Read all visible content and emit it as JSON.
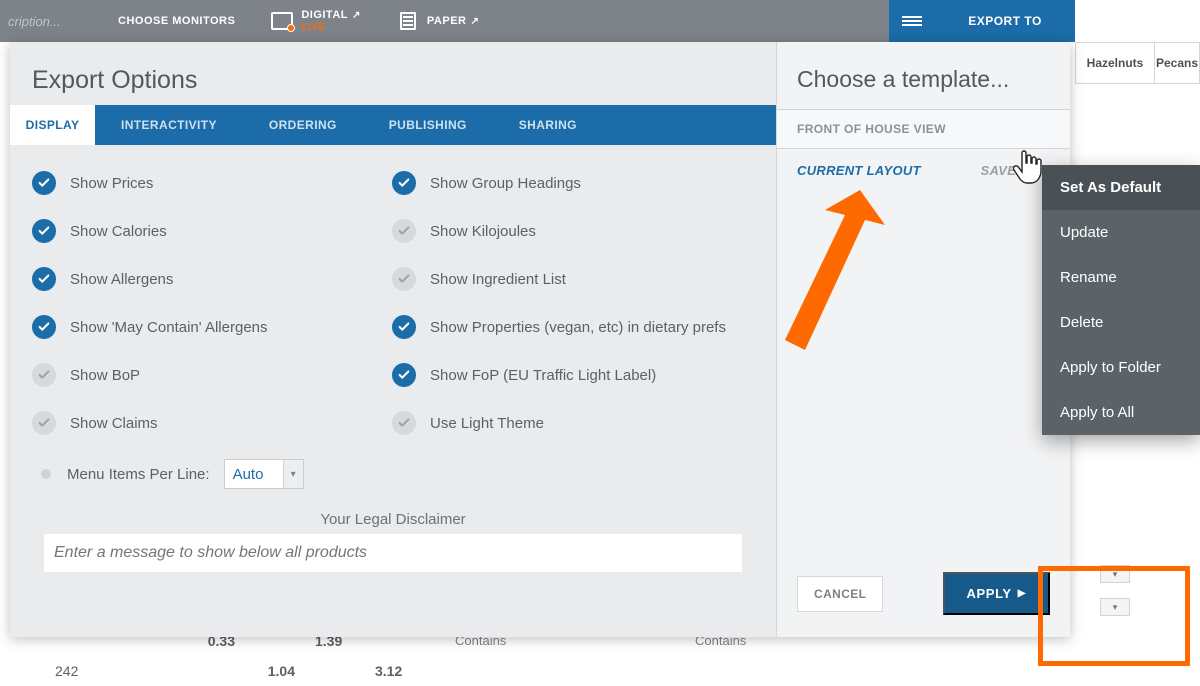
{
  "toolbar": {
    "description_placeholder": "cription...",
    "choose_monitors": "CHOOSE MONITORS",
    "digital": "DIGITAL",
    "digital_sub": "LIVE",
    "paper": "PAPER",
    "export_to": "EXPORT TO"
  },
  "bg_tabs": {
    "hazelnuts": "Hazelnuts",
    "pecans": "Pecans"
  },
  "panel": {
    "title": "Export Options",
    "tabs": [
      "DISPLAY",
      "INTERACTIVITY",
      "ORDERING",
      "PUBLISHING",
      "SHARING"
    ],
    "active_tab": 0,
    "options_left": [
      {
        "label": "Show Prices",
        "on": true
      },
      {
        "label": "Show Calories",
        "on": true
      },
      {
        "label": "Show Allergens",
        "on": true
      },
      {
        "label": "Show 'May Contain' Allergens",
        "on": true
      },
      {
        "label": "Show BoP",
        "on": false
      },
      {
        "label": "Show Claims",
        "on": false
      }
    ],
    "options_right": [
      {
        "label": "Show Group Headings",
        "on": true
      },
      {
        "label": "Show Kilojoules",
        "on": false
      },
      {
        "label": "Show Ingredient List",
        "on": false
      },
      {
        "label": "Show Properties (vegan, etc) in dietary prefs",
        "on": true
      },
      {
        "label": "Show FoP (EU Traffic Light Label)",
        "on": true
      },
      {
        "label": "Use Light Theme",
        "on": false
      }
    ],
    "per_line_label": "Menu Items Per Line:",
    "per_line_value": "Auto",
    "legal_label": "Your Legal Disclaimer",
    "legal_placeholder": "Enter a message to show below all products"
  },
  "template": {
    "title": "Choose a template...",
    "section": "FRONT OF HOUSE VIEW",
    "current": "CURRENT LAYOUT",
    "save_as": "SAVE AS...",
    "cancel": "CANCEL",
    "apply": "APPLY"
  },
  "context_menu": [
    "Set As Default",
    "Update",
    "Rename",
    "Delete",
    "Apply to Folder",
    "Apply to All"
  ],
  "bg_data": {
    "row1": {
      "a": "0.33",
      "b": "1.39",
      "c": "Contains",
      "d": "Contains"
    },
    "row2": {
      "id": "242",
      "a": "1.04",
      "b": "3.12"
    }
  }
}
